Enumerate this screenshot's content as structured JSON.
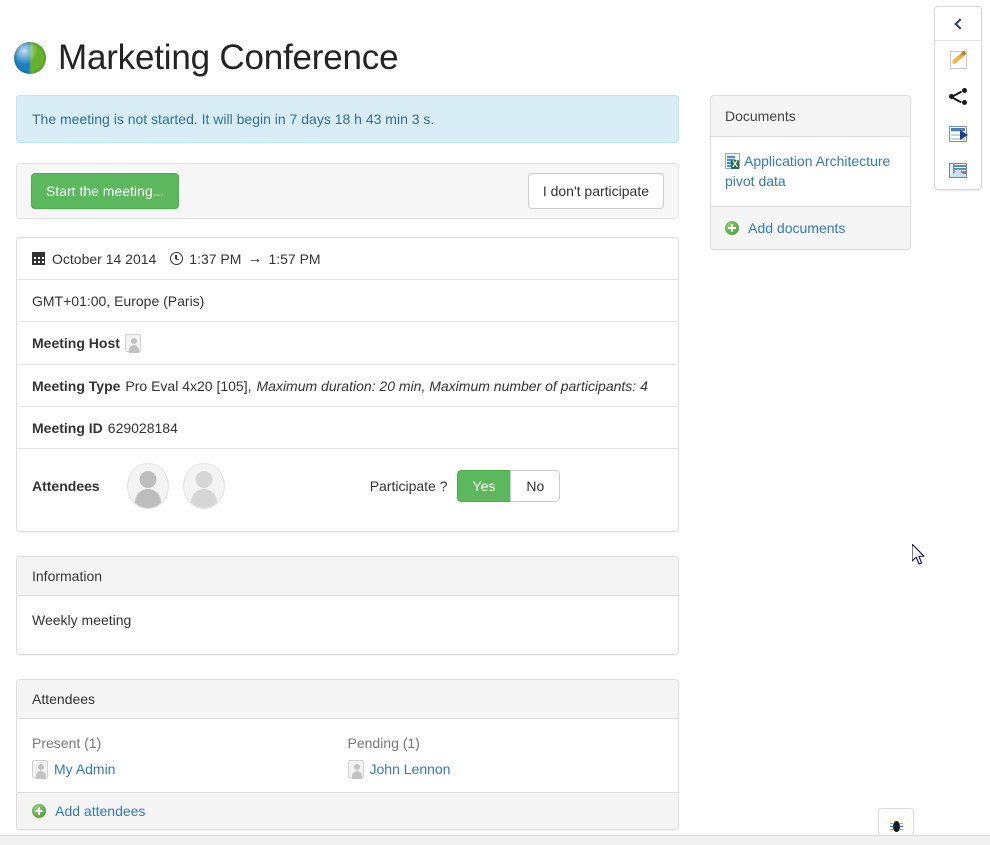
{
  "header": {
    "title": "Marketing Conference",
    "icon": "globe-icon"
  },
  "alert": {
    "message": "The meeting is not started. It will begin in 7 days 18 h 43 min 3 s.",
    "color": "#d9edf7",
    "text_color": "#31708f"
  },
  "actions": {
    "start_label": "Start the meeting...",
    "decline_label": "I don't participate",
    "start_color": "#5cb85c"
  },
  "details": {
    "date": "October 14 2014",
    "time_start": "1:37 PM",
    "time_arrow": "→",
    "time_end": "1:57 PM",
    "timezone": "GMT+01:00, Europe (Paris)",
    "host_label": "Meeting Host",
    "type_label": "Meeting Type",
    "type_value": "Pro Eval 4x20 [105],",
    "type_meta": "Maximum duration: 20 min, Maximum number of participants: 4",
    "id_label": "Meeting ID",
    "id_value": "629028184",
    "attendees_label": "Attendees",
    "participate_label": "Participate ?",
    "participate_yes": "Yes",
    "participate_no": "No",
    "participate_selected": "Yes"
  },
  "information": {
    "heading": "Information",
    "body": "Weekly meeting"
  },
  "attendees_panel": {
    "heading": "Attendees",
    "present_label": "Present (1)",
    "pending_label": "Pending (1)",
    "present": [
      {
        "name": "My Admin"
      }
    ],
    "pending": [
      {
        "name": "John Lennon"
      }
    ],
    "add_label": "Add attendees"
  },
  "documents": {
    "heading": "Documents",
    "items": [
      {
        "name": "Application Architecture pivot data",
        "icon": "excel-file-icon"
      }
    ],
    "add_label": "Add documents"
  },
  "toolbar": {
    "collapse": "collapse-panel",
    "items": [
      {
        "icon": "edit-icon"
      },
      {
        "icon": "share-icon"
      },
      {
        "icon": "export-spreadsheet-icon"
      },
      {
        "icon": "send-email-icon"
      }
    ]
  },
  "debug": {
    "icon": "bug-icon"
  },
  "link_color": "#337ab7"
}
